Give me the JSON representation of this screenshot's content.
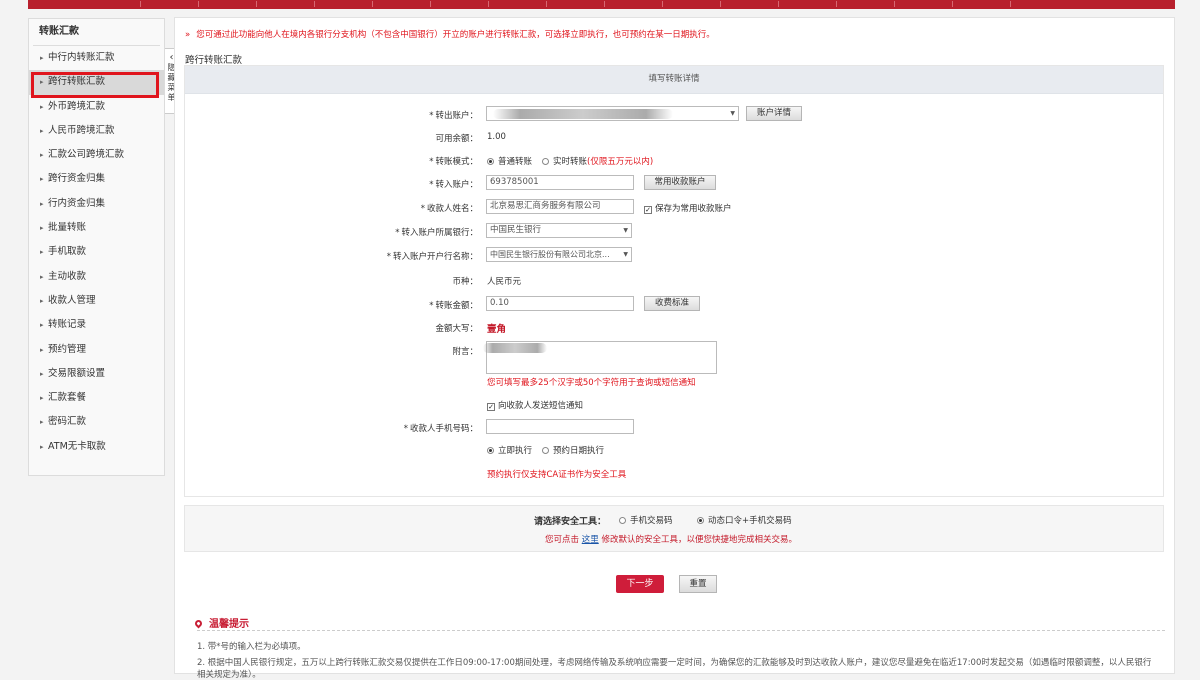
{
  "sidebar": {
    "title": "转账汇款",
    "items": [
      {
        "label": "中行内转账汇款"
      },
      {
        "label": "跨行转账汇款"
      },
      {
        "label": "外币跨境汇款"
      },
      {
        "label": "人民币跨境汇款"
      },
      {
        "label": "汇款公司跨境汇款"
      },
      {
        "label": "跨行资金归集"
      },
      {
        "label": "行内资金归集"
      },
      {
        "label": "批量转账"
      },
      {
        "label": "手机取款"
      },
      {
        "label": "主动收款"
      },
      {
        "label": "收款人管理"
      },
      {
        "label": "转账记录"
      },
      {
        "label": "预约管理"
      },
      {
        "label": "交易限额设置"
      },
      {
        "label": "汇款套餐"
      },
      {
        "label": "密码汇款"
      },
      {
        "label": "ATM无卡取款"
      }
    ]
  },
  "toggle": {
    "chevron": "‹",
    "label": "隐藏菜单"
  },
  "notice": {
    "prefix": "»",
    "text": "您可通过此功能向他人在境内各银行分支机构（不包含中国银行）开立的账户进行转账汇款，可选择立即执行，也可预约在某一日期执行。"
  },
  "section_title": "跨行转账汇款",
  "form": {
    "header": "填写转账详情",
    "from_account_label": "转出账户：",
    "account_detail_button": "账户详情",
    "balance_label": "可用余额：",
    "balance_value": "1.00",
    "mode_label": "转账模式：",
    "mode_normal": "普通转账",
    "mode_realtime": "实时转账",
    "mode_realtime_note": "(仅限五万元以内)",
    "to_account_label": "转入账户：",
    "to_account_value": "693785001",
    "common_payee_button": "常用收款账户",
    "payee_name_label": "收款人姓名：",
    "payee_name_value": "北京易思汇商务服务有限公司",
    "save_payee_label": "保存为常用收款账户",
    "bank_label": "转入账户所属银行：",
    "bank_value": "中国民生银行",
    "branch_label": "转入账户开户行名称：",
    "branch_value": "中国民生银行股份有限公司北京...",
    "currency_label": "币种：",
    "currency_value": "人民币元",
    "amount_label": "转账金额：",
    "amount_value": "0.10",
    "fee_button": "收费标准",
    "amount_upper_label": "金额大写：",
    "amount_upper_value": "壹角",
    "memo_label": "附言：",
    "memo_hint": "您可填写最多25个汉字或50个字符用于查询或短信通知",
    "sms_label": "向收款人发送短信通知",
    "phone_label": "收款人手机号码：",
    "exec_now": "立即执行",
    "exec_later": "预约日期执行",
    "exec_note": "预约执行仅支持CA证书作为安全工具"
  },
  "security": {
    "label": "请选择安全工具：",
    "option1": "手机交易码",
    "option2": "动态口令+手机交易码",
    "note_pre": "您可点击",
    "note_link": "这里",
    "note_post": "修改默认的安全工具，以便您快捷地完成相关交易。"
  },
  "actions": {
    "next": "下一步",
    "reset": "重置"
  },
  "tips": {
    "title": "温馨提示",
    "line1": "1. 带*号的输入栏为必填项。",
    "line2": "2. 根据中国人民银行规定，五万以上跨行转账汇款交易仅提供在工作日09:00-17:00期间处理，考虑网络传输及系统响应需要一定时间，为确保您的汇款能够及时到达收款人账户，建议您尽量避免在临近17:00时发起交易（如遇临时限额调整，以人民银行",
    "line3": "相关规定为准）。"
  },
  "colors": {
    "brand_red": "#b8202d",
    "alert_red": "#e0151d",
    "button_red": "#cf1d3a",
    "highlight": "#e0151d"
  }
}
